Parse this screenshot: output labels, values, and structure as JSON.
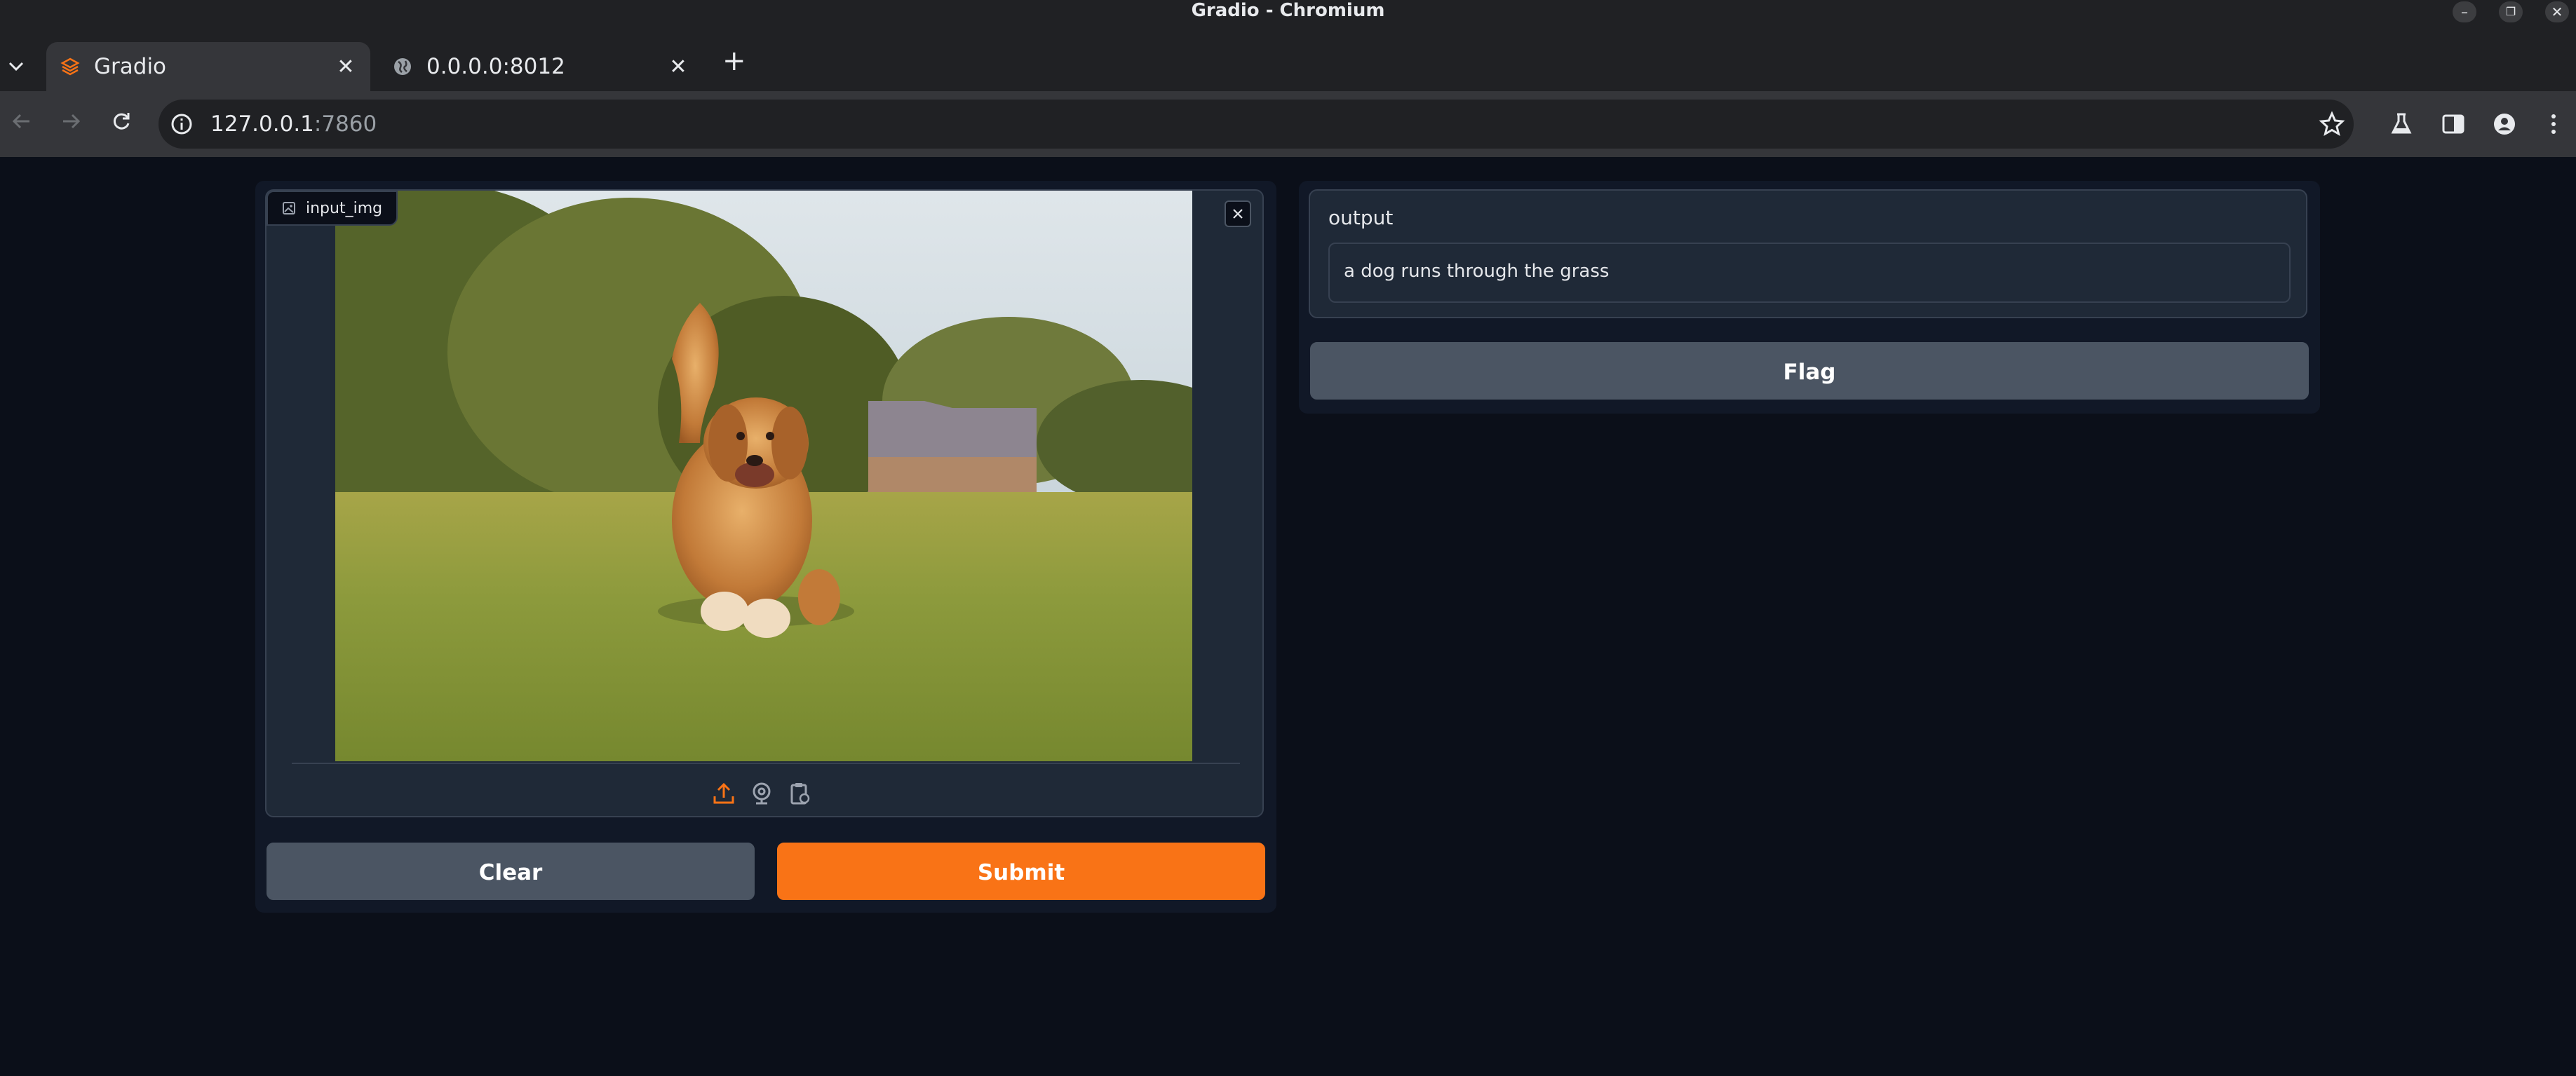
{
  "window": {
    "title": "Gradio - Chromium"
  },
  "tabs": [
    {
      "label": "Gradio",
      "active": true,
      "icon": "gradio-icon"
    },
    {
      "label": "0.0.0.0:8012",
      "active": false,
      "icon": "globe-icon"
    }
  ],
  "address_bar": {
    "host": "127.0.0.1",
    "port": ":7860"
  },
  "colors": {
    "accent": "#f97316",
    "background": "#0b0f19",
    "panel": "#111827",
    "block": "#1f2937",
    "secondary_button": "#4b5563"
  },
  "input_panel": {
    "image_label": "input_img",
    "image_description": "golden retriever running on grass",
    "sources": [
      "upload-icon",
      "webcam-icon",
      "clipboard-icon"
    ],
    "clear_label": "Clear",
    "submit_label": "Submit"
  },
  "output_panel": {
    "label": "output",
    "value": "a dog runs through the grass",
    "flag_label": "Flag"
  }
}
